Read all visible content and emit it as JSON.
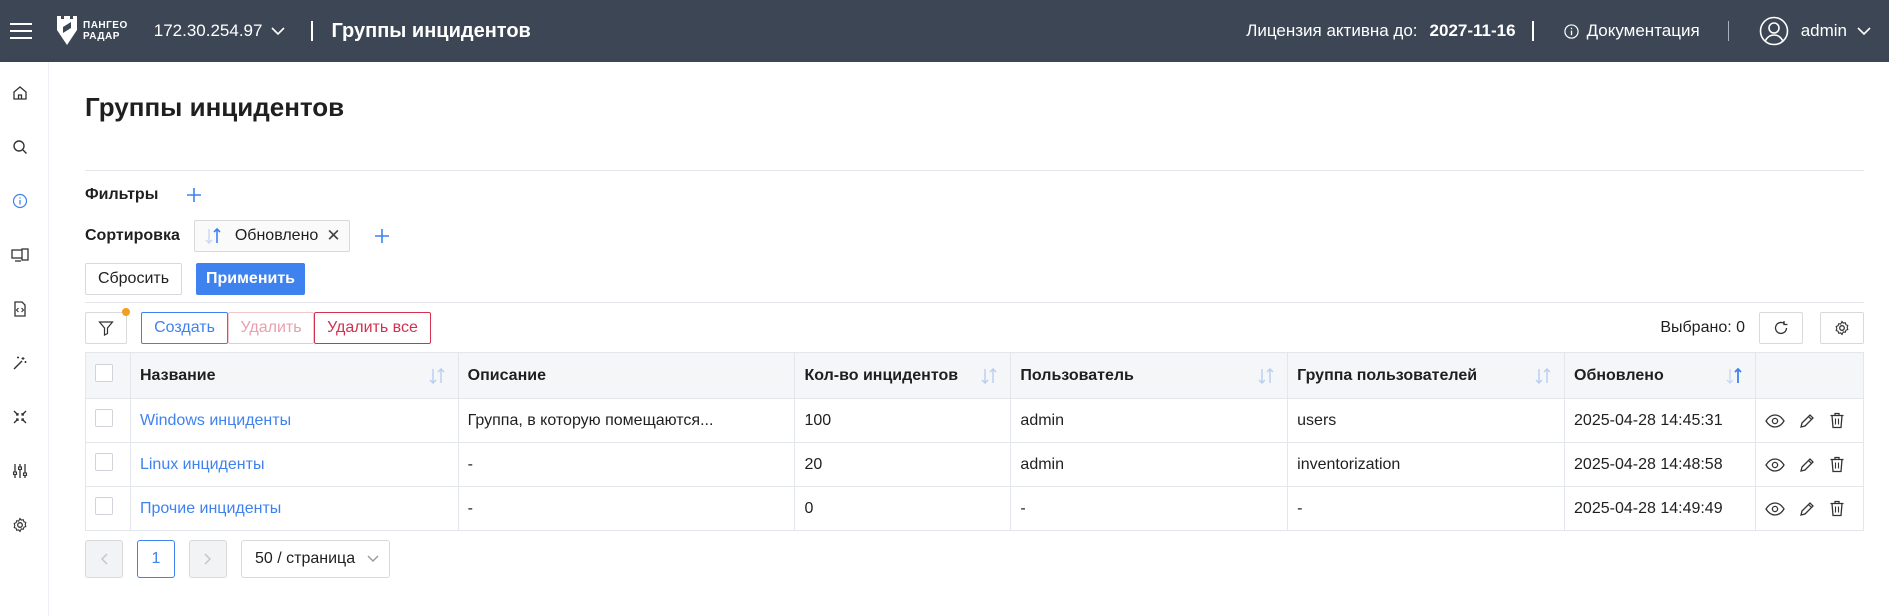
{
  "header": {
    "logo_line1": "ПАНГЕО",
    "logo_line2": "РАДАР",
    "ip": "172.30.254.97",
    "title": "Группы инцидентов",
    "license_label": "Лицензия активна до:",
    "license_date": "2027-11-16",
    "docs_label": "Документация",
    "user": "admin"
  },
  "sidebar": {
    "items": [
      "home-icon",
      "search-icon",
      "info-icon",
      "devices-icon",
      "code-file-icon",
      "magic-wand-icon",
      "collapse-icon",
      "sliders-icon",
      "gear-icon"
    ],
    "active": "info-icon"
  },
  "page": {
    "title": "Группы инцидентов"
  },
  "filters": {
    "label": "Фильтры"
  },
  "sorting": {
    "label": "Сортировка",
    "chip_label": "Обновлено"
  },
  "buttons": {
    "reset": "Сбросить",
    "apply": "Применить",
    "create": "Создать",
    "delete": "Удалить",
    "delete_all": "Удалить все"
  },
  "toolbar": {
    "selected": "Выбрано: 0"
  },
  "table": {
    "columns": [
      "Название",
      "Описание",
      "Кол-во инцидентов",
      "Пользователь",
      "Группа пользователей",
      "Обновлено"
    ],
    "rows": [
      {
        "name": "Windows инциденты",
        "description": "Группа, в которую помещаются...",
        "count": "100",
        "user": "admin",
        "group": "users",
        "updated": "2025-04-28 14:45:31"
      },
      {
        "name": "Linux инциденты",
        "description": "-",
        "count": "20",
        "user": "admin",
        "group": "inventorization",
        "updated": "2025-04-28 14:48:58"
      },
      {
        "name": "Прочие инциденты",
        "description": "-",
        "count": "0",
        "user": "-",
        "group": "-",
        "updated": "2025-04-28 14:49:49"
      }
    ]
  },
  "pagination": {
    "current_page": "1",
    "page_size": "50 / страница"
  },
  "colors": {
    "topbar": "#3c4654",
    "accent": "#3e82f0",
    "danger": "#d0324f",
    "badge": "#f0a020"
  }
}
